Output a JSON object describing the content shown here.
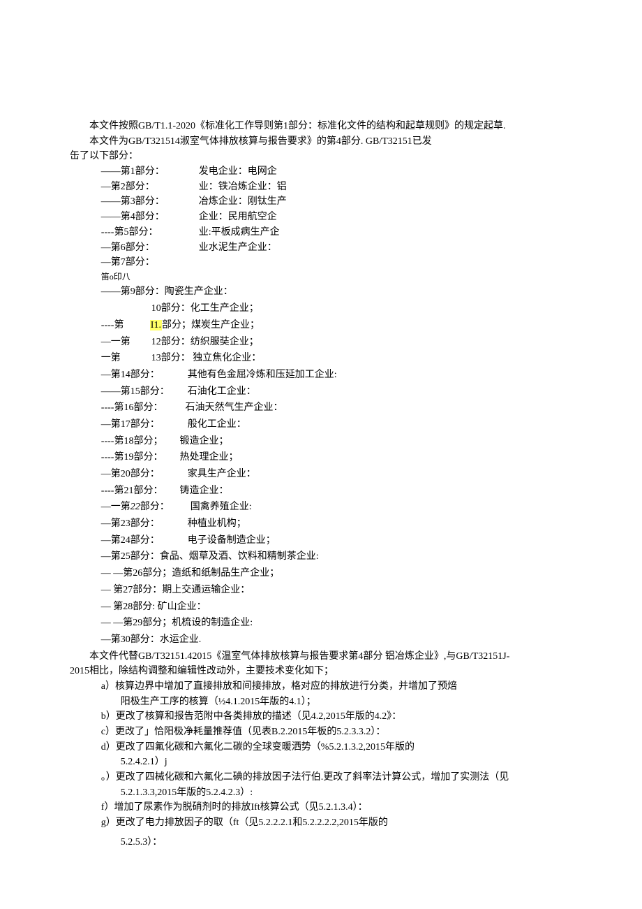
{
  "intro1": "本文件按照GB/T1.1-2020《标准化工作导则第1部分：标准化文件的结构和起草规则》的规定起草.",
  "intro2a": "本文件为GB/T321514淑室气体排放核算与报告要求》的第4部分. GB/T32151已发",
  "intro2b": "缶了以下部分：",
  "partsA": [
    {
      "d": "——",
      "n": "第1部分："
    },
    {
      "d": "—",
      "n": "第2部分："
    },
    {
      "d": "——",
      "n": "第3部分："
    },
    {
      "d": "——",
      "n": "第4部分："
    },
    {
      "d": "----",
      "n": "第5部分："
    },
    {
      "d": "—",
      "n": "第6部分："
    },
    {
      "d": "—",
      "n": "第7部分："
    },
    {
      "d": "",
      "n": "笛o印八"
    }
  ],
  "partsA_right": [
    "发电企业：电网企",
    "业：铁冶炼企业：铝",
    "冶炼企业：刚钛生产",
    "企业：民用航空企",
    "业:平板成病生产企",
    "业水泥生产企业："
  ],
  "part9": {
    "d": "——",
    "t": "第9部分：陶瓷生产企业："
  },
  "partsB": [
    {
      "lead": "",
      "n": "10部分：",
      "t": "化工生产企业；"
    },
    {
      "lead": "----第",
      "n": "",
      "hl": "I1.",
      "t": "部分；煤炭生产企业；"
    },
    {
      "lead": "—一第",
      "n": "12部分：",
      "t": "纺织服奘企业；"
    },
    {
      "lead": "一第",
      "n": "13部分：",
      "t": " 独立焦化企业："
    }
  ],
  "partsC": [
    {
      "d": "—",
      "n": "第14部分：",
      "t": "其他有色金屈冷炼和压延加工企业:"
    },
    {
      "d": "——",
      "n": "第15部分：",
      "t": "石油化工企业："
    },
    {
      "d": "----",
      "n": "第16部分：",
      "t": "石油天然气生产企业："
    },
    {
      "d": "—",
      "n": "第17部分：",
      "t": "般化工企业："
    },
    {
      "d": "----",
      "n": "第18部分；",
      "t": "锻造企业；"
    },
    {
      "d": "----",
      "n": "第19部分：",
      "t": "热处理企业；"
    },
    {
      "d": "—",
      "n": "第20部分：",
      "t": "家具生产企业："
    },
    {
      "d": "----",
      "n": "第21部分：",
      "t": "铸造企业："
    },
    {
      "d": "—一",
      "n": "第",
      "it": "22",
      "n2": "部分：",
      "t": "国禽养殖企业:"
    },
    {
      "d": "—",
      "n": "第23部分：",
      "t": "种植业机构；"
    },
    {
      "d": "—",
      "n": "第24部分：",
      "t": "电子设备制造企业；"
    }
  ],
  "partsD": [
    {
      "d": "—",
      "t": "第25部分：食品、烟草及酒、饮料和精制茶企业:"
    },
    {
      "d": "—  —",
      "t": "第26部分；造纸和纸制品生产企业；"
    },
    {
      "d": "—       ",
      "t": "第27部分：期上交通运输企业："
    },
    {
      "d": "—        ",
      "t": "第28部分: 矿山企业："
    },
    {
      "d": "—  —",
      "t": "第29部分；机梳设的制造企业:"
    },
    {
      "d": "—",
      "t": "第30部分：水运企业."
    }
  ],
  "replace1": "本文件代替GB/T32151.42015《温室气体排放核算与报告要求第4部分 铝冶炼企业》,与GB/T32151J-",
  "replace2": "2015相比，除结构调整和编辑性改动外，主要技术变化如下；",
  "changes": [
    {
      "k": "a）",
      "t": "核算边界中增加了直接排放和间接排放，格对应的排放进行分类，并增加了预焙",
      "sub": "阳极生产工序的核算（½4.1.2015年版的4.1）；"
    },
    {
      "k": "b）",
      "t": "更改了核算和报告范附中各类排放的描述（见4.2,2015年版的4.2》："
    },
    {
      "k": "c）",
      "t": "更改了」恰阳极净耗量推荐值（见表B.2.2015年板的5.2.3.3.2）："
    },
    {
      "k": "d）",
      "t": "更改了四氟化碳和六氟化二碳的全球变暖洒势（%5.2.1.3.2,2015年版的",
      "sub": "5.2.4.2.1）j"
    },
    {
      "k": "。）",
      "t": "更改了四械化碳和六氟化二碘的排放因子法行伯.更改了斜率法计算公式，增加了实测法（见",
      "sub": "5.2.1.3.3,2015年版的5.2.4.2.3）:"
    },
    {
      "k": "f）",
      "t": "增加了尿素作为脱硝剂时的排放Ift核算公式（见5.2.1.3.4）："
    },
    {
      "k": "g）",
      "t": "更改了电力排放因子的取（ft（见5.2.2.2.1和5.2.2.2.2,2015年版的",
      "sub": "5.2.5.3）："
    }
  ]
}
